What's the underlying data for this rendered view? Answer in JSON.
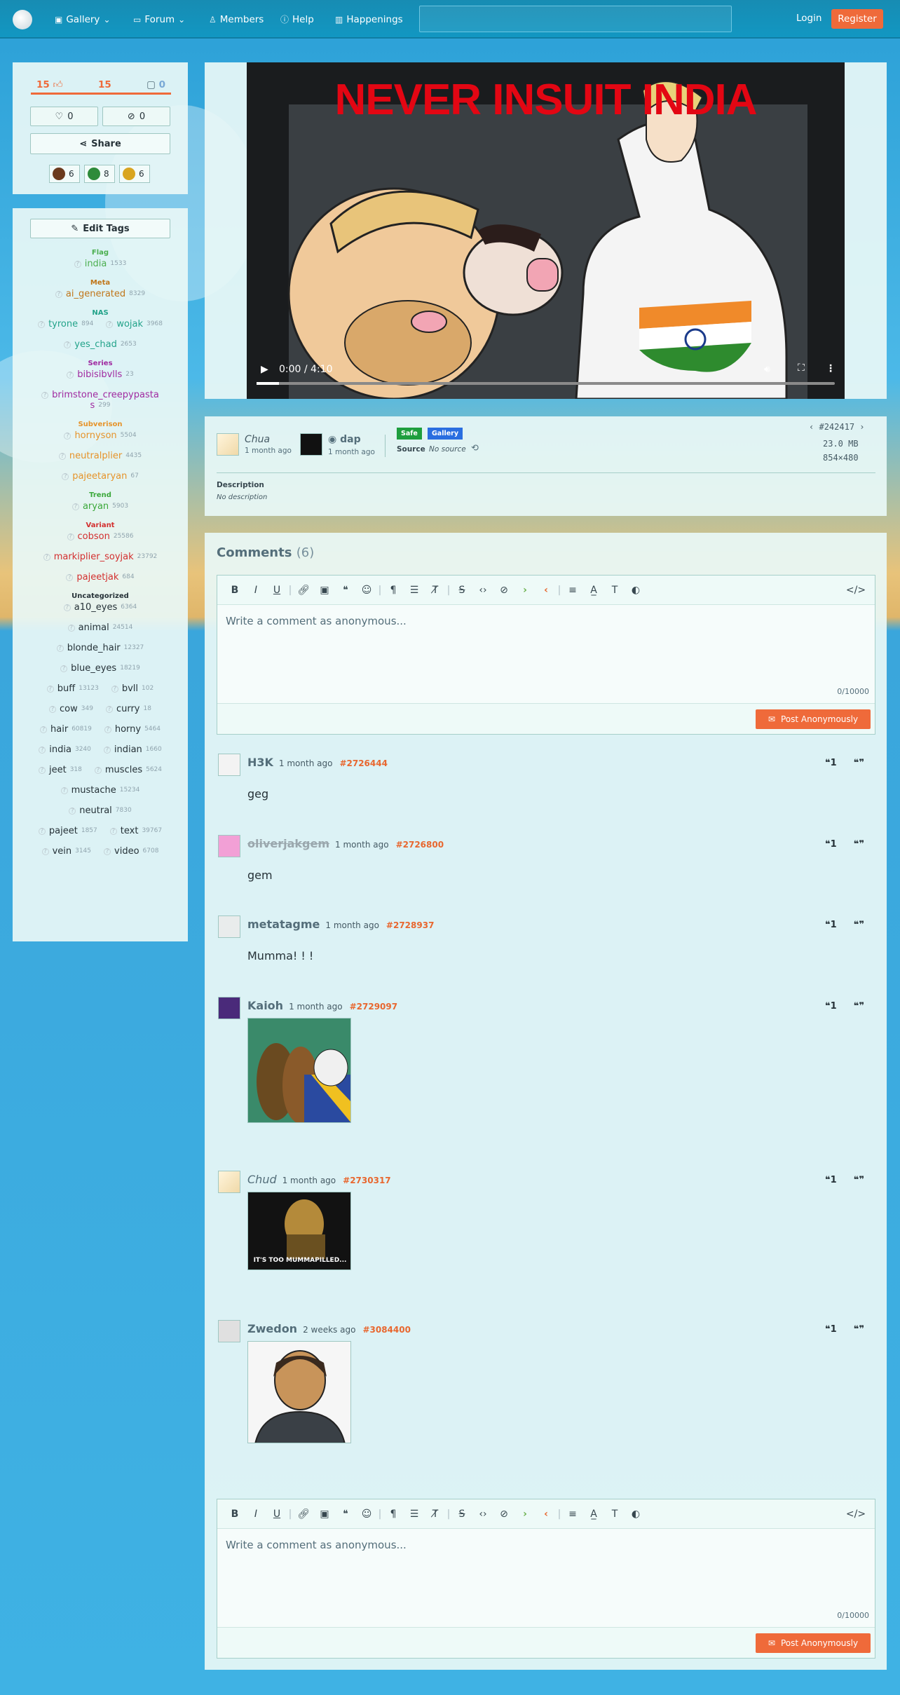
{
  "nav": {
    "gallery": "Gallery",
    "forum": "Forum",
    "members": "Members",
    "help": "Help",
    "happenings": "Happenings",
    "search_placeholder": "",
    "login": "Login",
    "register": "Register"
  },
  "votes": {
    "score": "15",
    "up": "15",
    "comments": "0",
    "faves": "0",
    "hides": "0",
    "share": "Share"
  },
  "reactions": [
    {
      "count": "6",
      "color": "#6b3a1e"
    },
    {
      "count": "8",
      "color": "#2e8b3a"
    },
    {
      "count": "6",
      "color": "#d9a520"
    }
  ],
  "tags": {
    "edit_label": "Edit Tags",
    "groups": [
      {
        "name": "Flag",
        "cls": "c-flag",
        "rows": [
          [
            {
              "n": "india",
              "c": "1533"
            }
          ]
        ]
      },
      {
        "name": "Meta",
        "cls": "c-meta",
        "rows": [
          [
            {
              "n": "ai_generated",
              "c": "8329"
            }
          ]
        ]
      },
      {
        "name": "NAS",
        "cls": "c-nas",
        "rows": [
          [
            {
              "n": "tyrone",
              "c": "894"
            },
            {
              "n": "wojak",
              "c": "3968"
            }
          ],
          [
            {
              "n": "yes_chad",
              "c": "2653"
            }
          ]
        ]
      },
      {
        "name": "Series",
        "cls": "c-series",
        "rows": [
          [
            {
              "n": "bibisibvlls",
              "c": "23"
            }
          ],
          [
            {
              "n": "brimstone_creepypastas",
              "c": "299"
            }
          ]
        ]
      },
      {
        "name": "Subverison",
        "cls": "c-sub",
        "rows": [
          [
            {
              "n": "hornyson",
              "c": "5504"
            }
          ],
          [
            {
              "n": "neutralplier",
              "c": "4435"
            }
          ],
          [
            {
              "n": "pajeetaryan",
              "c": "67"
            }
          ]
        ]
      },
      {
        "name": "Trend",
        "cls": "c-trend",
        "rows": [
          [
            {
              "n": "aryan",
              "c": "5903"
            }
          ]
        ]
      },
      {
        "name": "Variant",
        "cls": "c-var",
        "rows": [
          [
            {
              "n": "cobson",
              "c": "25586"
            }
          ],
          [
            {
              "n": "markiplier_soyjak",
              "c": "23792"
            }
          ],
          [
            {
              "n": "pajeetjak",
              "c": "684"
            }
          ]
        ]
      },
      {
        "name": "Uncategorized",
        "cls": "c-unc",
        "rows": [
          [
            {
              "n": "a10_eyes",
              "c": "6364"
            }
          ],
          [
            {
              "n": "animal",
              "c": "24514"
            }
          ],
          [
            {
              "n": "blonde_hair",
              "c": "12327"
            }
          ],
          [
            {
              "n": "blue_eyes",
              "c": "18219"
            }
          ],
          [
            {
              "n": "buff",
              "c": "13123"
            },
            {
              "n": "bvll",
              "c": "102"
            }
          ],
          [
            {
              "n": "cow",
              "c": "349"
            },
            {
              "n": "curry",
              "c": "18"
            }
          ],
          [
            {
              "n": "hair",
              "c": "60819"
            },
            {
              "n": "horny",
              "c": "5464"
            }
          ],
          [
            {
              "n": "india",
              "c": "3240"
            },
            {
              "n": "indian",
              "c": "1660"
            }
          ],
          [
            {
              "n": "jeet",
              "c": "318"
            },
            {
              "n": "muscles",
              "c": "5624"
            }
          ],
          [
            {
              "n": "mustache",
              "c": "15234"
            }
          ],
          [
            {
              "n": "neutral",
              "c": "7830"
            }
          ],
          [
            {
              "n": "pajeet",
              "c": "1857"
            },
            {
              "n": "text",
              "c": "39767"
            }
          ],
          [
            {
              "n": "vein",
              "c": "3145"
            },
            {
              "n": "video",
              "c": "6708"
            }
          ]
        ]
      }
    ]
  },
  "video": {
    "overlay_text": "NEVER INSUIT INDIA",
    "time": "0:00 / 4:10"
  },
  "info": {
    "uploader": "Chua",
    "uploader_time": "1 month ago",
    "approver": "dap",
    "approver_time": "1 month ago",
    "rating": "Safe",
    "section": "Gallery",
    "source_label": "Source",
    "source_value": "No source",
    "post_id": "#242417",
    "size": "23.0 MB",
    "dims": "854×480",
    "desc_label": "Description",
    "desc_value": "No description"
  },
  "comments_header": {
    "title": "Comments",
    "count": "(6)"
  },
  "editor": {
    "placeholder": "Write a comment as anonymous...",
    "counter": "0/10000",
    "post": "Post Anonymously"
  },
  "comments": [
    {
      "name": "H3K",
      "time": "1 month ago",
      "id": "#2726444",
      "text": "geg"
    },
    {
      "name": "oliverjakgem",
      "time": "1 month ago",
      "id": "#2726800",
      "text": "gem"
    },
    {
      "name": "metatagme",
      "time": "1 month ago",
      "id": "#2728937",
      "text": "Mumma! ! !"
    },
    {
      "name": "Kaioh",
      "time": "1 month ago",
      "id": "#2729097",
      "text": ""
    },
    {
      "name": "Chud",
      "time": "1 month ago",
      "id": "#2730317",
      "text": "",
      "img_text": "IT'S TOO MUMMAPILLED..."
    },
    {
      "name": "Zwedon",
      "time": "2 weeks ago",
      "id": "#3084400",
      "text": ""
    }
  ]
}
